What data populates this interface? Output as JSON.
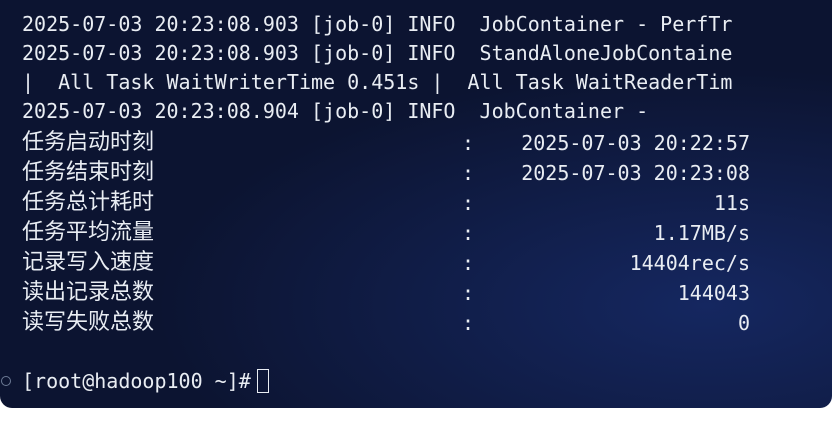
{
  "log_lines": [
    "2025-07-03 20:23:08.903 [job-0] INFO  JobContainer - PerfTr",
    "2025-07-03 20:23:08.903 [job-0] INFO  StandAloneJobContaine",
    "|  All Task WaitWriterTime 0.451s |  All Task WaitReaderTim",
    "2025-07-03 20:23:08.904 [job-0] INFO  JobContainer -"
  ],
  "stats": [
    {
      "label": "任务启动时刻",
      "colon": ":",
      "value": "2025-07-03 20:22:57"
    },
    {
      "label": "任务结束时刻",
      "colon": ":",
      "value": "2025-07-03 20:23:08"
    },
    {
      "label": "任务总计耗时",
      "colon": ":",
      "value": "11s"
    },
    {
      "label": "任务平均流量",
      "colon": ":",
      "value": "1.17MB/s"
    },
    {
      "label": "记录写入速度",
      "colon": ":",
      "value": "14404rec/s"
    },
    {
      "label": "读出记录总数",
      "colon": ":",
      "value": "144043"
    },
    {
      "label": "读写失败总数",
      "colon": ":",
      "value": "0"
    }
  ],
  "prompt": {
    "text": "[root@hadoop100 ~]#"
  }
}
